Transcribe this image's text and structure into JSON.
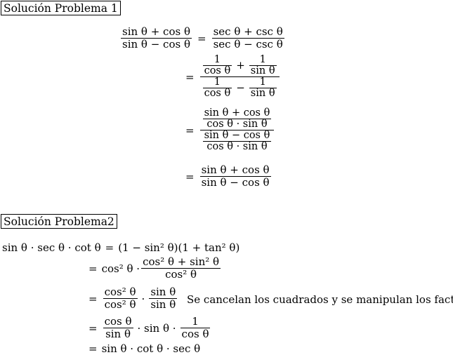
{
  "problem1": {
    "title": "Solución Problema 1",
    "lhs": {
      "num": "sin θ + cos θ",
      "den": "sin θ − cos θ"
    },
    "step1": {
      "num": "sec θ + csc θ",
      "den": "sec θ − csc θ"
    },
    "step2": {
      "one": "1",
      "cos": "cos θ",
      "sin": "sin θ",
      "plus": "+",
      "minus": "−"
    },
    "step3": {
      "num_top": "sin θ + cos θ",
      "num_bot": "cos θ · sin θ",
      "den_top": "sin θ − cos θ",
      "den_bot": "cos θ · sin θ"
    },
    "step4": {
      "num": "sin θ + cos θ",
      "den": "sin θ − cos θ"
    },
    "equals": "="
  },
  "problem2": {
    "title": "Solución Problema2",
    "lhs": "sin θ · sec θ · cot θ",
    "line1": "(1 − sin² θ)(1 + tan² θ)",
    "line2": {
      "pre": "cos² θ ·",
      "num": "cos² θ + sin² θ",
      "den": "cos² θ"
    },
    "line3": {
      "f1_num": "cos² θ",
      "f1_den": "cos² θ",
      "dot": "·",
      "f2_num": "sin θ",
      "f2_den": "sin θ"
    },
    "line3_note": "Se cancelan los cuadrados y se manipulan los factores",
    "line4": {
      "f1_num": "cos θ",
      "f1_den": "sin θ",
      "mid": "· sin θ ·",
      "f2_num": "1",
      "f2_den": "cos θ"
    },
    "line5": "sin θ · cot θ · sec θ",
    "equals": "="
  }
}
